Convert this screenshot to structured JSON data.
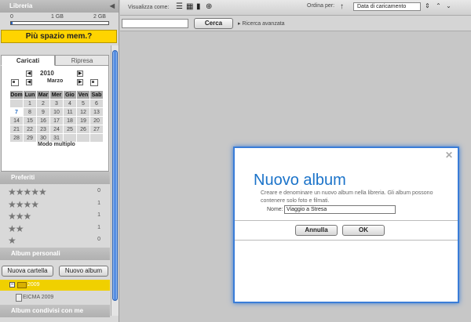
{
  "sidebar": {
    "title": "Libreria",
    "collapse_icon": "triangle-left",
    "storage": {
      "min": "0",
      "mid": "1 GB",
      "max": "2 GB",
      "fraction_used": 0.02
    },
    "more_space": "Più spazio mem.?",
    "tabs": [
      {
        "label": "Caricati",
        "active": true
      },
      {
        "label": "Ripresa",
        "active": false
      }
    ],
    "calendar": {
      "year": "2010",
      "month": "Marzo",
      "weekdays": [
        "Dom",
        "Lun",
        "Mar",
        "Mer",
        "Gio",
        "Ven",
        "Sab"
      ],
      "weeks": [
        [
          "",
          "1",
          "2",
          "3",
          "4",
          "5",
          "6"
        ],
        [
          "7",
          "8",
          "9",
          "10",
          "11",
          "12",
          "13"
        ],
        [
          "14",
          "15",
          "16",
          "17",
          "18",
          "19",
          "20"
        ],
        [
          "21",
          "22",
          "23",
          "24",
          "25",
          "26",
          "27"
        ],
        [
          "28",
          "29",
          "30",
          "31",
          "",
          "",
          ""
        ]
      ],
      "highlighted_day": "7",
      "multi_mode": "Modo multiplo"
    },
    "favorites": {
      "title": "Preferiti",
      "rows": [
        {
          "stars": 5,
          "glyphs": "★★★★★",
          "count": "0"
        },
        {
          "stars": 4,
          "glyphs": "★★★★",
          "count": "1"
        },
        {
          "stars": 3,
          "glyphs": "★★★",
          "count": "1"
        },
        {
          "stars": 2,
          "glyphs": "★★",
          "count": "1"
        },
        {
          "stars": 1,
          "glyphs": "★",
          "count": "0"
        }
      ]
    },
    "albums": {
      "title": "Album personali",
      "new_folder": "Nuova cartella",
      "new_album": "Nuovo album",
      "folder_name": "2009",
      "album_name": "EICMA 2009"
    },
    "shared_albums_title": "Album condivisi con me"
  },
  "toolbar": {
    "view_label": "Visualizza come:",
    "view_icons": [
      "list-icon",
      "grid-icon",
      "filmstrip-icon",
      "globe-icon"
    ],
    "sort_label": "Ordina per:",
    "sort_value": "Data di caricamento"
  },
  "search": {
    "value": "",
    "button": "Cerca",
    "advanced": "Ricerca avanzata"
  },
  "dialog": {
    "title": "Nuovo album",
    "description": "Creare e denominare un nuovo album nella libreria. Gli album possono contenere solo foto e filmati.",
    "name_label": "Nome:",
    "name_value": "Viaggio a Stresa",
    "cancel": "Annulla",
    "ok": "OK"
  },
  "colors": {
    "accent_blue": "#1b73c9",
    "highlight_yellow": "#ffd400",
    "dialog_border": "#3a7dd8"
  }
}
